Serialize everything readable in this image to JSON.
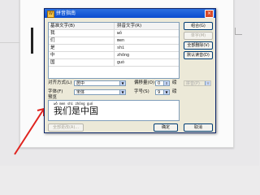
{
  "dialog": {
    "title": "拼音指南",
    "close_label": "×",
    "base_col_header": "基准文字(B)",
    "ruby_col_header": "拼音文字(R)",
    "rows": [
      {
        "base": "我",
        "ruby": "wǒ"
      },
      {
        "base": "们",
        "ruby": "men"
      },
      {
        "base": "是",
        "ruby": "shì"
      },
      {
        "base": "中",
        "ruby": "zhōng"
      },
      {
        "base": "国",
        "ruby": "guó"
      }
    ],
    "buttons": {
      "combine": "组合(G)",
      "single": "单字(M)",
      "clear_all": "全部删除(V)",
      "default_reading": "默认读音(D)",
      "pinyin_mode": "拼音(P)",
      "ok": "确定",
      "cancel": "取消",
      "change_all": "全部更改(A)..."
    },
    "alignment_label": "对齐方式(L)",
    "alignment_value": "居中",
    "offset_label": "偏移量(O)",
    "offset_value": "0",
    "offset_unit": "磅",
    "font_label": "字体(F)",
    "font_value": "宋体",
    "size_label": "字号(S)",
    "size_value": "9",
    "size_unit": "磅",
    "preview_label": "预览",
    "preview_pinyin": "wǒ men shì zhōng guó",
    "preview_text": "我们是中国"
  }
}
